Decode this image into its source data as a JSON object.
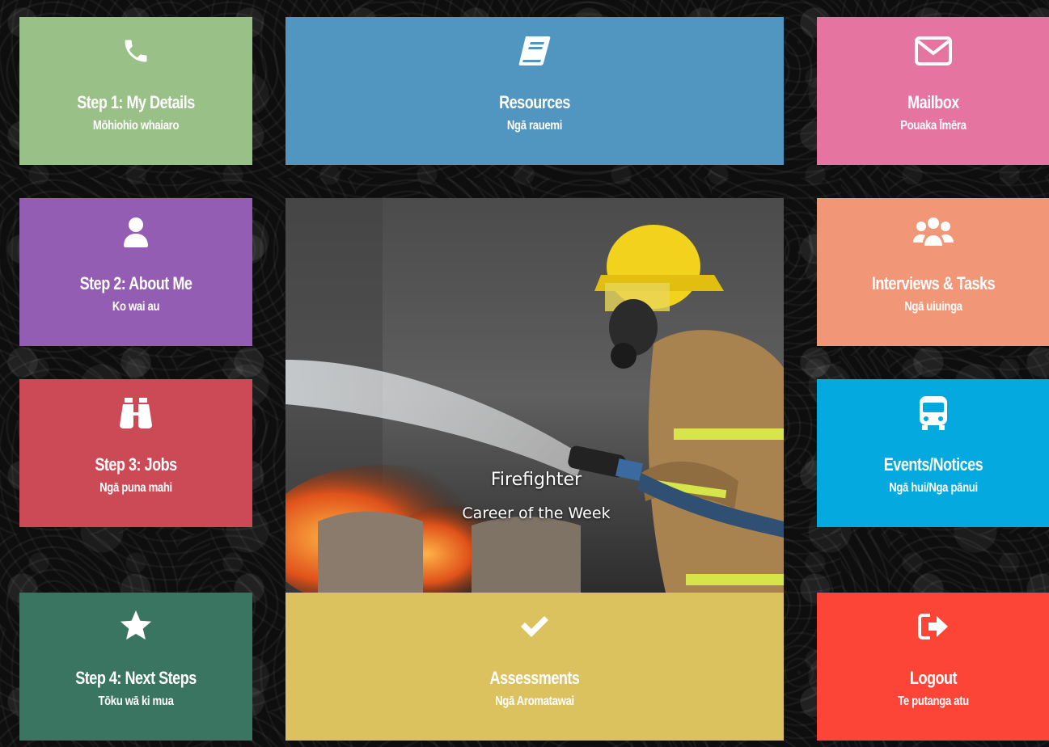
{
  "tiles": {
    "details": {
      "title": "Step 1: My Details",
      "subtitle": "Mōhiohio whaiaro",
      "icon": "phone-icon",
      "color": "#98c087"
    },
    "about": {
      "title": "Step 2: About Me",
      "subtitle": "Ko wai au",
      "icon": "user-icon",
      "color": "#925db3"
    },
    "jobs": {
      "title": "Step 3: Jobs",
      "subtitle": "Ngā puna mahi",
      "icon": "binoculars-icon",
      "color": "#cb4a56"
    },
    "next": {
      "title": "Step 4: Next Steps",
      "subtitle": "Tōku wā ki mua",
      "icon": "star-icon",
      "color": "#3a7561"
    },
    "resources": {
      "title": "Resources",
      "subtitle": "Ngā rauemi",
      "icon": "book-icon",
      "color": "#5196c1"
    },
    "assessments": {
      "title": "Assessments",
      "subtitle": "Ngā Aromatawai",
      "icon": "check-icon",
      "color": "#dcc15f"
    },
    "mailbox": {
      "title": "Mailbox",
      "subtitle": "Pouaka Īmēra",
      "icon": "envelope-icon",
      "color": "#e574a0"
    },
    "interviews": {
      "title": "Interviews & Tasks",
      "subtitle": "Ngā uiuinga",
      "icon": "users-icon",
      "color": "#f19676"
    },
    "events": {
      "title": "Events/Notices",
      "subtitle": "Ngā hui/Nga pānui",
      "icon": "bus-icon",
      "color": "#03a9df"
    },
    "logout": {
      "title": "Logout",
      "subtitle": "Te putanga atu",
      "icon": "sign-out-icon",
      "color": "#fd4537"
    }
  },
  "feature": {
    "title": "Firefighter",
    "subtitle": "Career of the Week"
  }
}
